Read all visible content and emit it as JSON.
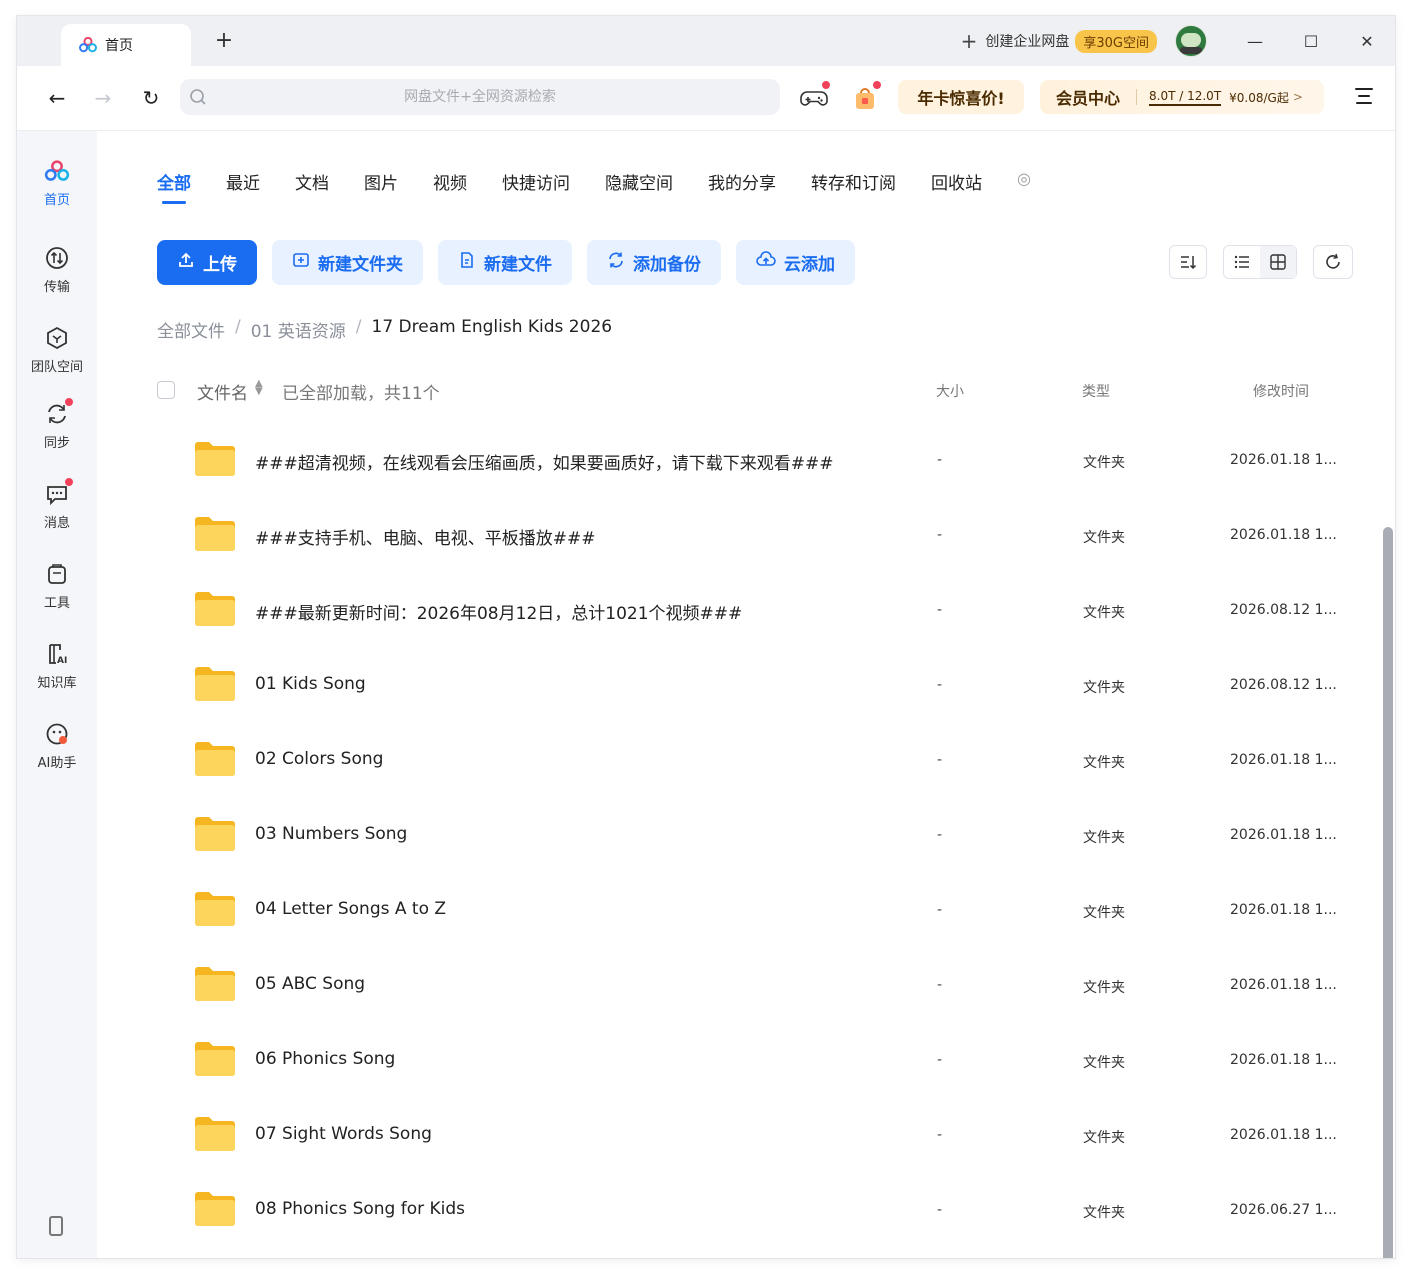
{
  "tab": {
    "label": "首页"
  },
  "titlebar": {
    "add_tab": "+",
    "enterprise_plus": "+",
    "enterprise_label": "创建企业网盘",
    "enterprise_badge": "享30G空间",
    "minimize": "—",
    "maximize": "☐",
    "close": "✕"
  },
  "nav": {
    "back": "←",
    "forward": "→",
    "refresh": "↻",
    "search_placeholder": "网盘文件+全网资源检索",
    "promo_label": "年卡惊喜价!",
    "vip_label": "会员中心",
    "vip_storage": "8.0T / 12.0T",
    "vip_price": "¥0.08/G起",
    "vip_arrow": ">"
  },
  "sidebar": {
    "items": [
      {
        "label": "首页",
        "icon": "home-logo-icon"
      },
      {
        "label": "传输",
        "icon": "transfer-icon"
      },
      {
        "label": "团队空间",
        "icon": "team-space-icon"
      },
      {
        "label": "同步",
        "icon": "sync-icon"
      },
      {
        "label": "消息",
        "icon": "message-icon"
      },
      {
        "label": "工具",
        "icon": "tools-icon"
      },
      {
        "label": "知识库",
        "icon": "knowledge-base-icon"
      },
      {
        "label": "AI助手",
        "icon": "ai-assistant-icon"
      }
    ]
  },
  "categories": [
    "全部",
    "最近",
    "文档",
    "图片",
    "视频",
    "快捷访问",
    "隐藏空间",
    "我的分享",
    "转存和订阅",
    "回收站"
  ],
  "toolbar": {
    "upload": "上传",
    "new_folder": "新建文件夹",
    "new_file": "新建文件",
    "add_backup": "添加备份",
    "cloud_add": "云添加"
  },
  "breadcrumb": [
    "全部文件",
    "01 英语资源",
    "17 Dream English Kids 2026"
  ],
  "breadcrumb_sep": "/",
  "list": {
    "col_name": "文件名",
    "loaded_text": "已全部加载，共11个",
    "col_size": "大小",
    "col_type": "类型",
    "col_time": "修改时间",
    "rows": [
      {
        "name": "###超清视频，在线观看会压缩画质，如果要画质好，请下载下来观看###",
        "size": "-",
        "type": "文件夹",
        "time": "2026.01.18 1..."
      },
      {
        "name": "###支持手机、电脑、电视、平板播放###",
        "size": "-",
        "type": "文件夹",
        "time": "2026.01.18 1..."
      },
      {
        "name": "###最新更新时间：2026年08月12日，总计1021个视频###",
        "size": "-",
        "type": "文件夹",
        "time": "2026.08.12 1..."
      },
      {
        "name": "01 Kids Song",
        "size": "-",
        "type": "文件夹",
        "time": "2026.08.12 1..."
      },
      {
        "name": "02 Colors Song",
        "size": "-",
        "type": "文件夹",
        "time": "2026.01.18 1..."
      },
      {
        "name": "03 Numbers Song",
        "size": "-",
        "type": "文件夹",
        "time": "2026.01.18 1..."
      },
      {
        "name": "04 Letter Songs A to Z",
        "size": "-",
        "type": "文件夹",
        "time": "2026.01.18 1..."
      },
      {
        "name": "05 ABC Song",
        "size": "-",
        "type": "文件夹",
        "time": "2026.01.18 1..."
      },
      {
        "name": "06 Phonics Song",
        "size": "-",
        "type": "文件夹",
        "time": "2026.01.18 1..."
      },
      {
        "name": "07 Sight Words Song",
        "size": "-",
        "type": "文件夹",
        "time": "2026.01.18 1..."
      },
      {
        "name": "08 Phonics Song for Kids",
        "size": "-",
        "type": "文件夹",
        "time": "2026.06.27 1..."
      }
    ]
  },
  "colors": {
    "accent": "#1a6cf0",
    "folder": "#fcc93a",
    "badge": "#f8c44a",
    "red_dot": "#f0425b"
  }
}
